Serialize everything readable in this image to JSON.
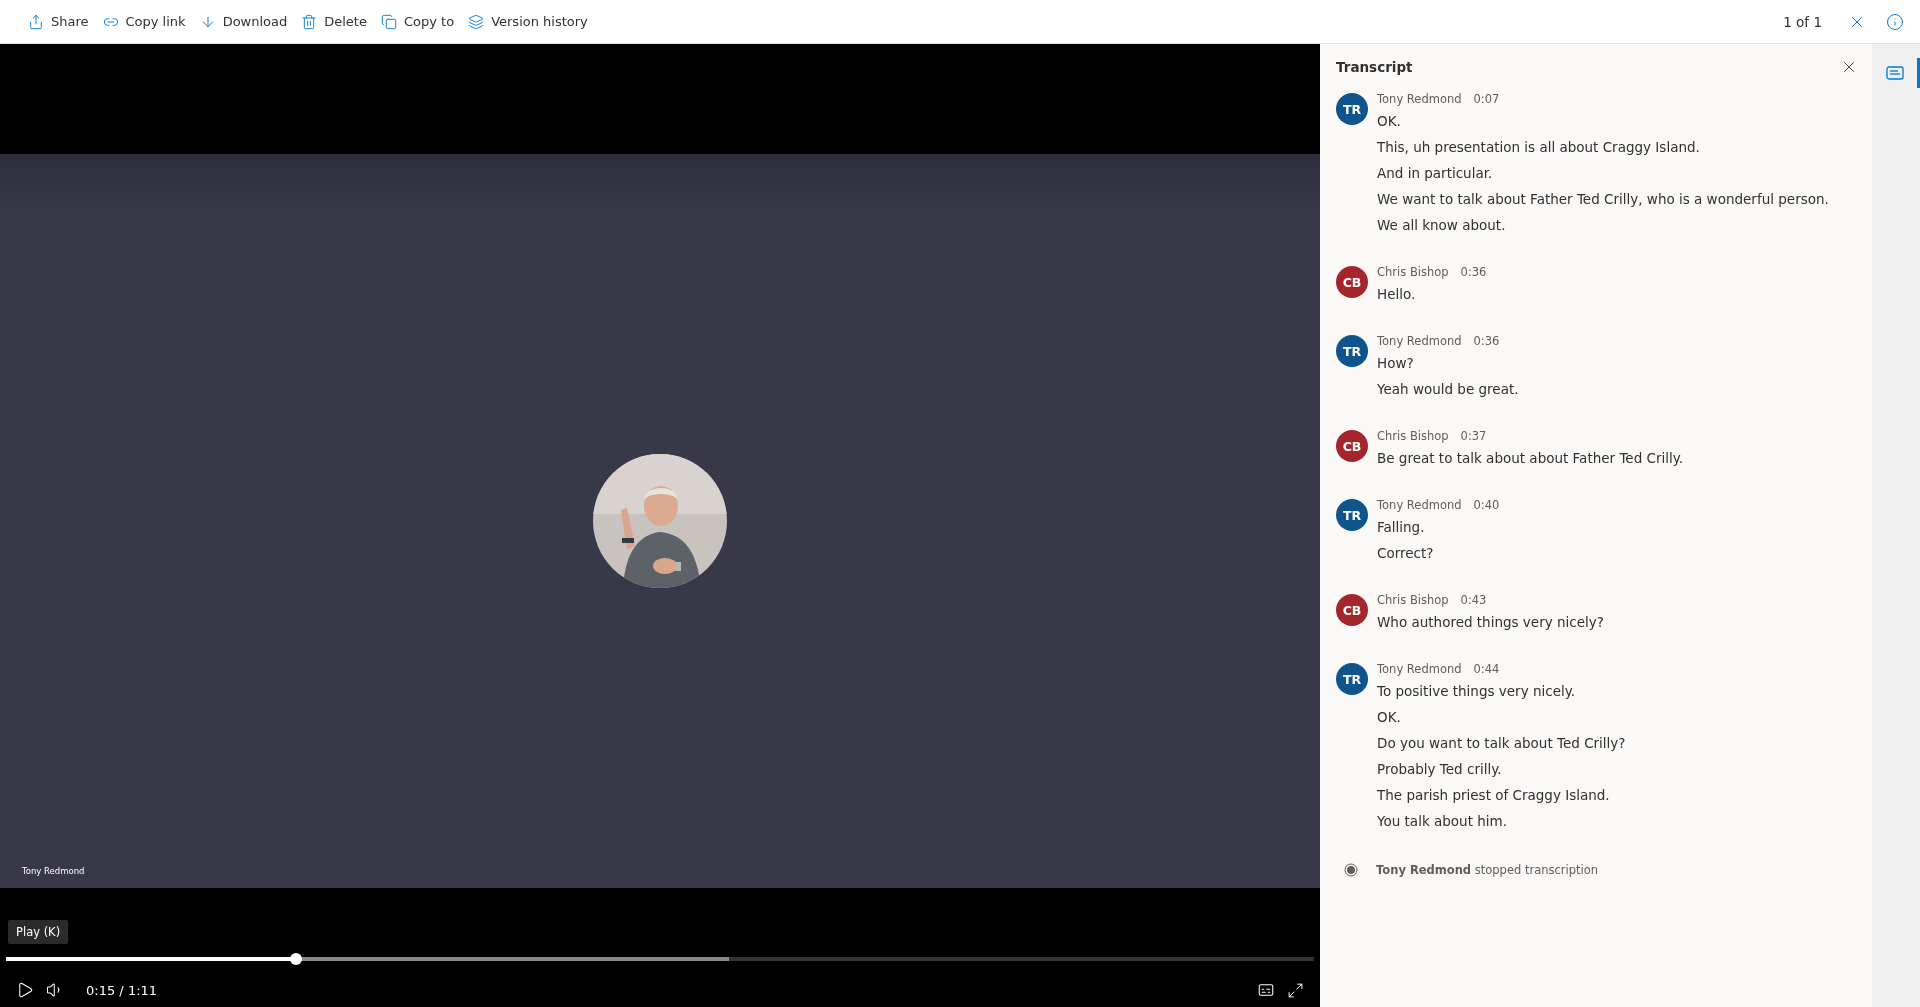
{
  "toolbar": {
    "actions": [
      {
        "kind": "share",
        "label": "Share"
      },
      {
        "kind": "link",
        "label": "Copy link"
      },
      {
        "kind": "download",
        "label": "Download"
      },
      {
        "kind": "delete",
        "label": "Delete"
      },
      {
        "kind": "copy",
        "label": "Copy to"
      },
      {
        "kind": "history",
        "label": "Version history"
      }
    ],
    "counter": "1 of 1"
  },
  "video": {
    "participant_name": "Tony Redmond",
    "tooltip": "Play (K)",
    "progress": {
      "level": 0.222,
      "buffer": {
        "level": 0.553
      }
    },
    "time": "0:15",
    "separator": "/",
    "duration": "1:11"
  },
  "transcript": {
    "title": "Transcript",
    "entries": [
      {
        "initials": "TR",
        "color": "#0f548c",
        "speaker": "Tony Redmond",
        "time": "0:07",
        "lines": [
          "OK.",
          "This, uh presentation is all about Craggy Island.",
          "And in particular.",
          "We want to talk about Father Ted Crilly, who is a wonderful person.",
          "We all know about."
        ]
      },
      {
        "initials": "CB",
        "color": "#a4262c",
        "speaker": "Chris Bishop",
        "time": "0:36",
        "lines": [
          "Hello."
        ]
      },
      {
        "initials": "TR",
        "color": "#0f548c",
        "speaker": "Tony Redmond",
        "time": "0:36",
        "lines": [
          "How?",
          "Yeah would be great."
        ]
      },
      {
        "initials": "CB",
        "color": "#a4262c",
        "speaker": "Chris Bishop",
        "time": "0:37",
        "lines": [
          "Be great to talk about about Father Ted Crilly."
        ]
      },
      {
        "initials": "TR",
        "color": "#0f548c",
        "speaker": "Tony Redmond",
        "time": "0:40",
        "lines": [
          "Falling.",
          "Correct?"
        ]
      },
      {
        "initials": "CB",
        "color": "#a4262c",
        "speaker": "Chris Bishop",
        "time": "0:43",
        "lines": [
          "Who authored things very nicely?"
        ]
      },
      {
        "initials": "TR",
        "color": "#0f548c",
        "speaker": "Tony Redmond",
        "time": "0:44",
        "lines": [
          "To positive things very nicely.",
          "OK.",
          "Do you want to talk about Ted Crilly?",
          "Probably Ted crilly.",
          "The parish priest of Craggy Island.",
          "You talk about him."
        ]
      }
    ],
    "event": "**Tony Redmond** stopped transcription"
  },
  "side_rail": {
    "items": [
      {
        "kind": "transcript",
        "selected": true
      }
    ]
  }
}
